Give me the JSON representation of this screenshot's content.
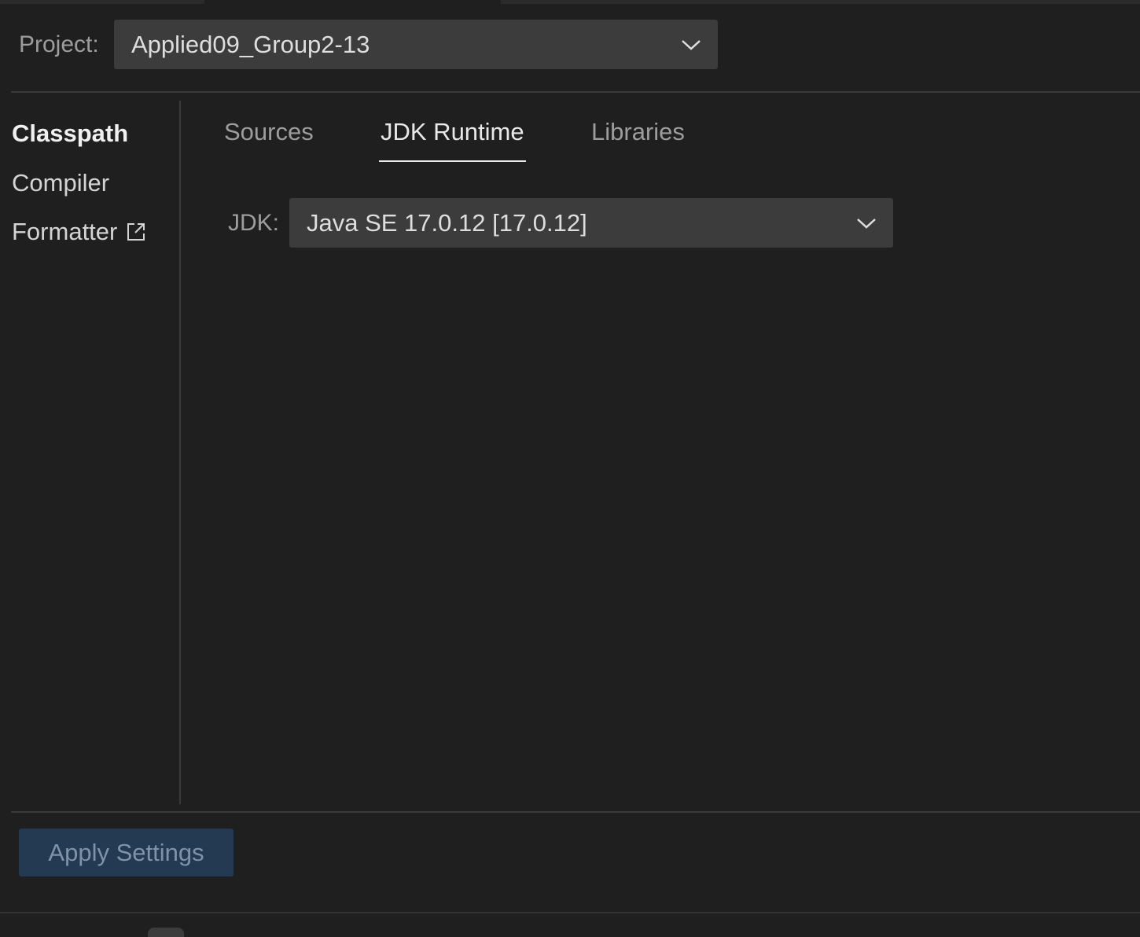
{
  "project": {
    "label": "Project:",
    "selected": "Applied09_Group2-13",
    "icon": "chevron-down-icon"
  },
  "sidebar": {
    "items": [
      {
        "label": "Classpath",
        "active": true
      },
      {
        "label": "Compiler",
        "active": false
      },
      {
        "label": "Formatter",
        "active": false,
        "icon": "external-link-icon"
      }
    ]
  },
  "tabs": [
    {
      "label": "Sources",
      "active": false
    },
    {
      "label": "JDK Runtime",
      "active": true
    },
    {
      "label": "Libraries",
      "active": false
    }
  ],
  "jdk": {
    "label": "JDK:",
    "selected": "Java SE 17.0.12 [17.0.12]",
    "icon": "chevron-down-icon"
  },
  "footer": {
    "apply_label": "Apply Settings"
  },
  "colors": {
    "background": "#1f1f1f",
    "dropdown_bg": "#3c3c3c",
    "button_bg": "#243a52",
    "button_text": "#7f93a8"
  }
}
